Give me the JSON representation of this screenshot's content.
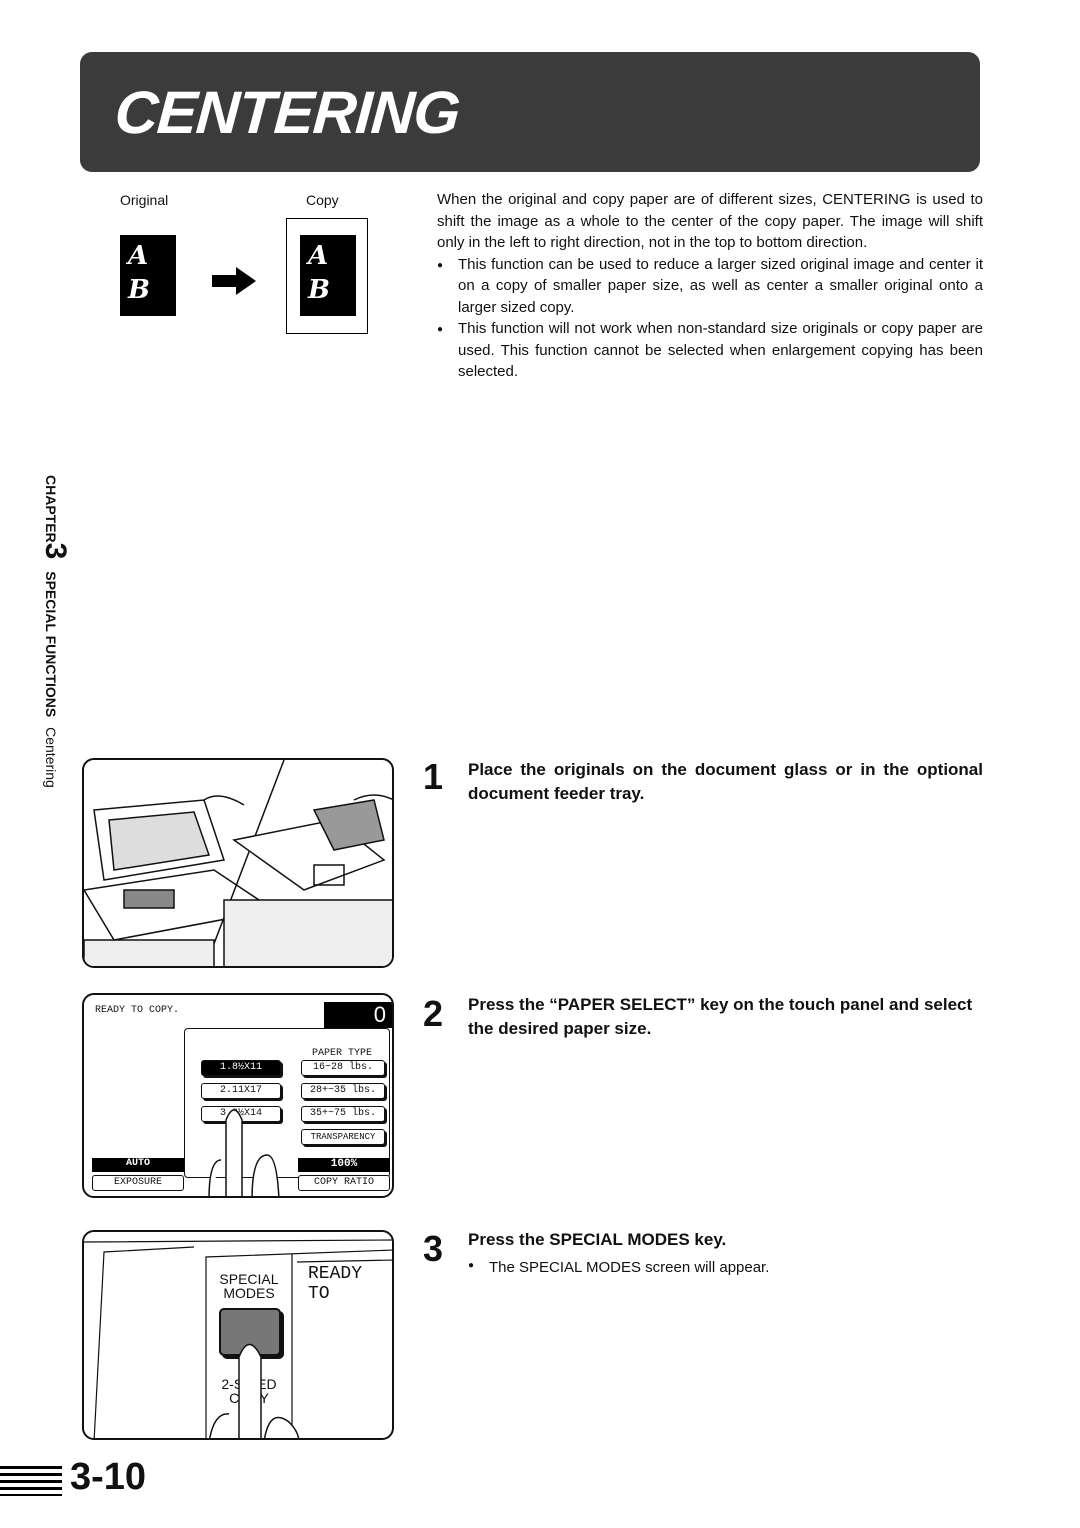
{
  "header": {
    "title": "CENTERING"
  },
  "figure": {
    "original_label": "Original",
    "copy_label": "Copy",
    "letters": [
      "A",
      "B"
    ]
  },
  "intro": {
    "paragraph": "When the original and copy paper are of different sizes, CENTERING is used to shift the image as a whole to the center of the copy paper. The image will shift only in the left to right direction, not in the top to bottom direction.",
    "bullets": [
      "This function can be used to reduce a larger sized original image and center it on a copy of smaller paper size, as well as center a smaller original onto a larger sized copy.",
      "This function will not work when non-standard size originals or copy paper are used. This function cannot be selected when enlargement copying has been selected."
    ]
  },
  "side": {
    "chapter": "CHAPTER",
    "chapter_num": "3",
    "section": "SPECIAL FUNCTIONS",
    "sub": "Centering"
  },
  "steps": [
    {
      "num": "1",
      "heading": "Place the originals on the document glass or in the optional document feeder tray."
    },
    {
      "num": "2",
      "heading": "Press the “PAPER SELECT” key on the touch panel and select the desired paper size."
    },
    {
      "num": "3",
      "heading": "Press the SPECIAL MODES key.",
      "bullet": "The SPECIAL MODES screen will appear."
    }
  ],
  "panel": {
    "status": "READY TO COPY.",
    "count": "0",
    "sizes": [
      "1.8½X11",
      "2.11X17",
      "3.8½X14"
    ],
    "paper_type_label": "PAPER TYPE",
    "paper_types": [
      "16~28  lbs.",
      "28+~35 lbs.",
      "35+~75 lbs.",
      "TRANSPARENCY"
    ],
    "exposure_value": "AUTO",
    "exposure_label": "EXPOSURE",
    "ratio_value": "100%",
    "ratio_label": "COPY RATIO"
  },
  "keypad": {
    "special_modes": "SPECIAL\nMODES",
    "duplex": "2-SIDED\nCOPY",
    "display": "READY TO"
  },
  "footer": {
    "page": "3-10"
  }
}
